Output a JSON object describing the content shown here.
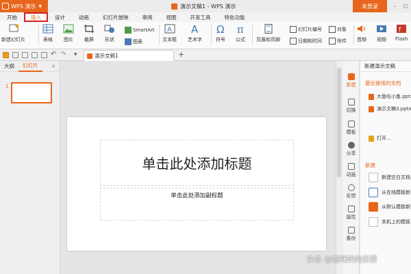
{
  "app": {
    "name": "WPS 演示",
    "window_title": "演示文稿1 - WPS 演示",
    "login_label": "未登录",
    "accent_color": "#e8661b",
    "highlight_color": "#d32020"
  },
  "tabs": [
    "开始",
    "插入",
    "设计",
    "动画",
    "幻灯片放映",
    "审阅",
    "视图",
    "开发工具",
    "特色功能"
  ],
  "active_tab": "插入",
  "ribbon": {
    "new_slide": "新建幻灯片",
    "table": "表格",
    "picture": "图片",
    "screenshot": "截屏",
    "shape": "形状",
    "smartart": "SmartArt",
    "chart": "图表",
    "textbox": "文本框",
    "wordart": "艺术字",
    "symbol": "符号",
    "formula": "公式",
    "header_footer": "页眉和页脚",
    "slide_number": "幻灯片编号",
    "date_time": "日期和时间",
    "object": "对象",
    "attachment": "附件",
    "audio": "音频",
    "video": "视频",
    "flash": "Flash"
  },
  "document_tab": "演示文稿1",
  "left_panel": {
    "tab_outline": "大纲",
    "tab_slides": "幻灯片",
    "slide_number": "1"
  },
  "slide": {
    "title_placeholder": "单击此处添加标题",
    "subtitle_placeholder": "单击此处添加副标题"
  },
  "side_icons": [
    "新建",
    "切换",
    "模板",
    "分享",
    "动画",
    "反馈",
    "属性",
    "备份"
  ],
  "task_pane": {
    "header": "新建演示文稿",
    "recent_section": "最近使用的文档",
    "recent_files": [
      "大鱼吃小鱼.pptx",
      "演示文稿3.pptx"
    ],
    "open_label": "打开...",
    "new_section": "新建",
    "new_items": [
      "新建空白文档",
      "从在线模板新建",
      "从默认模板新建",
      "本机上的模板"
    ]
  },
  "watermark": "头条 @猫咪的向日葵"
}
